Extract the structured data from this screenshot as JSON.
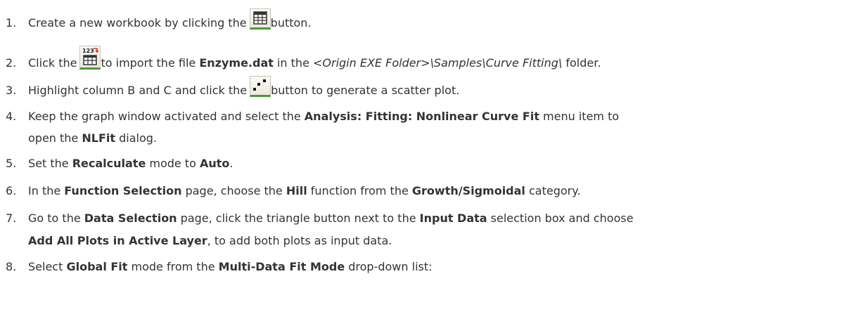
{
  "steps": [
    {
      "num": "1.",
      "before": "Create a new workbook by clicking the ",
      "icon": "new-workbook-icon",
      "after": "button."
    },
    {
      "num": "2.",
      "before": "Click the ",
      "icon": "import-ascii-icon",
      "after_1": "to import the file ",
      "bold_1": "Enzyme.dat",
      "after_2": " in the ",
      "italic_1": "<Origin EXE Folder>\\Samples\\Curve Fitting\\",
      "after_3": " folder."
    },
    {
      "num": "3.",
      "before": "Highlight column B and C and click the ",
      "icon": "scatter-plot-icon",
      "after": "button to generate a scatter plot."
    },
    {
      "num": "4.",
      "t1": "Keep the graph window activated and select the ",
      "b1": "Analysis: Fitting: Nonlinear Curve Fit",
      "t2": " menu item to",
      "t3": "open the ",
      "b2": "NLFit",
      "t4": " dialog."
    },
    {
      "num": "5.",
      "t1": "Set the ",
      "b1": "Recalculate",
      "t2": " mode to ",
      "b2": "Auto",
      "t3": "."
    },
    {
      "num": "6.",
      "t1": "In the ",
      "b1": "Function Selection",
      "t2": " page, choose the ",
      "b2": "Hill",
      "t3": " function from the ",
      "b3": "Growth/Sigmoidal",
      "t4": " category."
    },
    {
      "num": "7.",
      "t1": "Go to the ",
      "b1": "Data Selection",
      "t2": " page, click the triangle button next to the ",
      "b2": "Input Data",
      "t3": " selection box and choose",
      "b3": "Add All Plots in Active Layer",
      "t4": ", to add both plots as input data."
    },
    {
      "num": "8.",
      "t1": "Select ",
      "b1": "Global Fit",
      "t2": " mode from the ",
      "b2": "Multi-Data Fit Mode",
      "t3": " drop-down list:"
    }
  ]
}
